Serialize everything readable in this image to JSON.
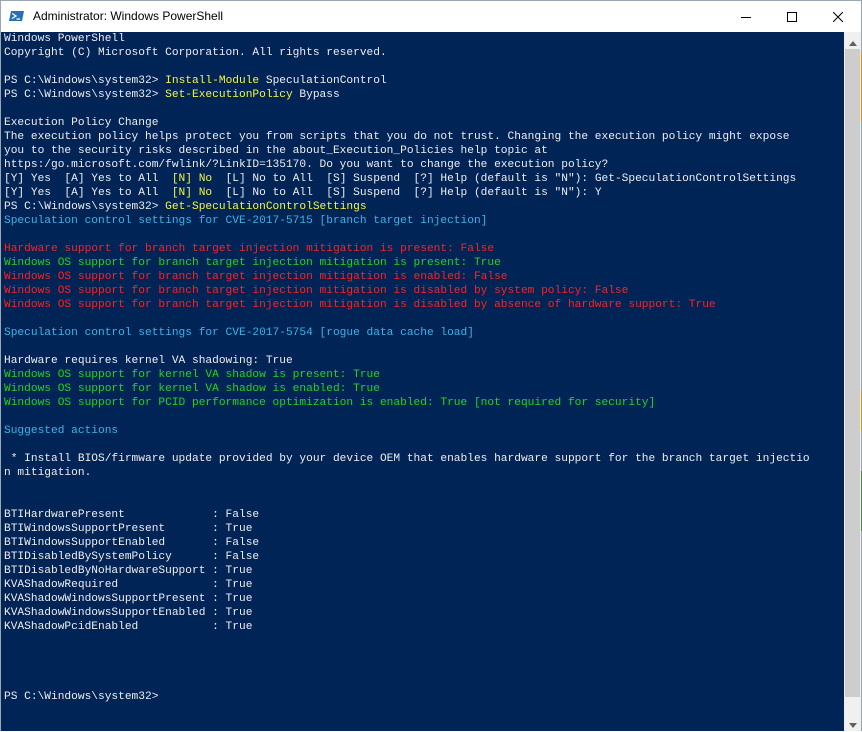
{
  "window": {
    "title": "Administrator: Windows PowerShell",
    "icon": "powershell-icon",
    "buttons": {
      "minimize": "minimize-icon",
      "maximize": "maximize-icon",
      "close": "close-icon"
    }
  },
  "colors": {
    "console_bg": "#012456",
    "default_text": "#eeedf0",
    "command": "#f5f543",
    "heading": "#3bb4e6",
    "error": "#ff2121",
    "ok": "#22d422"
  },
  "console_lines": [
    [
      {
        "t": "Windows PowerShell",
        "c": "default"
      }
    ],
    [
      {
        "t": "Copyright (C) Microsoft Corporation. All rights reserved.",
        "c": "default"
      }
    ],
    [],
    [
      {
        "t": "PS C:\\Windows\\system32> ",
        "c": "default"
      },
      {
        "t": "Install-Module",
        "c": "yellow"
      },
      {
        "t": " SpeculationControl",
        "c": "default"
      }
    ],
    [
      {
        "t": "PS C:\\Windows\\system32> ",
        "c": "default"
      },
      {
        "t": "Set-ExecutionPolicy",
        "c": "yellow"
      },
      {
        "t": " Bypass",
        "c": "default"
      }
    ],
    [],
    [
      {
        "t": "Execution Policy Change",
        "c": "default"
      }
    ],
    [
      {
        "t": "The execution policy helps protect you from scripts that you do not trust. Changing the execution policy might expose",
        "c": "default"
      }
    ],
    [
      {
        "t": "you to the security risks described in the about_Execution_Policies help topic at",
        "c": "default"
      }
    ],
    [
      {
        "t": "https:/go.microsoft.com/fwlink/?LinkID=135170. Do you want to change the execution policy?",
        "c": "default"
      }
    ],
    [
      {
        "t": "[Y] Yes  [A] Yes to All  ",
        "c": "default"
      },
      {
        "t": "[N] No",
        "c": "yellow"
      },
      {
        "t": "  [L] No to All  [S] Suspend  [?] Help (default is \"N\"): Get-SpeculationControlSettings",
        "c": "default"
      }
    ],
    [
      {
        "t": "[Y] Yes  [A] Yes to All  ",
        "c": "default"
      },
      {
        "t": "[N] No",
        "c": "yellow"
      },
      {
        "t": "  [L] No to All  [S] Suspend  [?] Help (default is \"N\"): Y",
        "c": "default"
      }
    ],
    [
      {
        "t": "PS C:\\Windows\\system32> ",
        "c": "default"
      },
      {
        "t": "Get-SpeculationControlSettings",
        "c": "yellow"
      }
    ],
    [
      {
        "t": "Speculation control settings for CVE-2017-5715 [branch target injection]",
        "c": "cyan"
      }
    ],
    [],
    [
      {
        "t": "Hardware support for branch target injection mitigation is present: False",
        "c": "red"
      }
    ],
    [
      {
        "t": "Windows OS support for branch target injection mitigation is present: True",
        "c": "green"
      }
    ],
    [
      {
        "t": "Windows OS support for branch target injection mitigation is enabled: False",
        "c": "red"
      }
    ],
    [
      {
        "t": "Windows OS support for branch target injection mitigation is disabled by system policy: False",
        "c": "red"
      }
    ],
    [
      {
        "t": "Windows OS support for branch target injection mitigation is disabled by absence of hardware support: True",
        "c": "red"
      }
    ],
    [],
    [
      {
        "t": "Speculation control settings for CVE-2017-5754 [rogue data cache load]",
        "c": "cyan"
      }
    ],
    [],
    [
      {
        "t": "Hardware requires kernel VA shadowing: True",
        "c": "default"
      }
    ],
    [
      {
        "t": "Windows OS support for kernel VA shadow is present: True",
        "c": "green"
      }
    ],
    [
      {
        "t": "Windows OS support for kernel VA shadow is enabled: True",
        "c": "green"
      }
    ],
    [
      {
        "t": "Windows OS support for PCID performance optimization is enabled: True [not required for security]",
        "c": "green"
      }
    ],
    [],
    [
      {
        "t": "Suggested actions",
        "c": "cyan"
      }
    ],
    [],
    [
      {
        "t": " * Install BIOS/firmware update provided by your device OEM that enables hardware support for the branch target injectio",
        "c": "default"
      }
    ],
    [
      {
        "t": "n mitigation.",
        "c": "default"
      }
    ],
    [],
    [],
    [
      {
        "t": "BTIHardwarePresent             : False",
        "c": "default"
      }
    ],
    [
      {
        "t": "BTIWindowsSupportPresent       : True",
        "c": "default"
      }
    ],
    [
      {
        "t": "BTIWindowsSupportEnabled       : False",
        "c": "default"
      }
    ],
    [
      {
        "t": "BTIDisabledBySystemPolicy      : False",
        "c": "default"
      }
    ],
    [
      {
        "t": "BTIDisabledByNoHardwareSupport : True",
        "c": "default"
      }
    ],
    [
      {
        "t": "KVAShadowRequired              : True",
        "c": "default"
      }
    ],
    [
      {
        "t": "KVAShadowWindowsSupportPresent : True",
        "c": "default"
      }
    ],
    [
      {
        "t": "KVAShadowWindowsSupportEnabled : True",
        "c": "default"
      }
    ],
    [
      {
        "t": "KVAShadowPcidEnabled           : True",
        "c": "default"
      }
    ],
    [],
    [],
    [],
    [],
    [
      {
        "t": "PS C:\\Windows\\system32>",
        "c": "default"
      }
    ]
  ],
  "scrollbar": {
    "up": "scroll-up-arrow-icon",
    "down": "scroll-down-arrow-icon"
  }
}
